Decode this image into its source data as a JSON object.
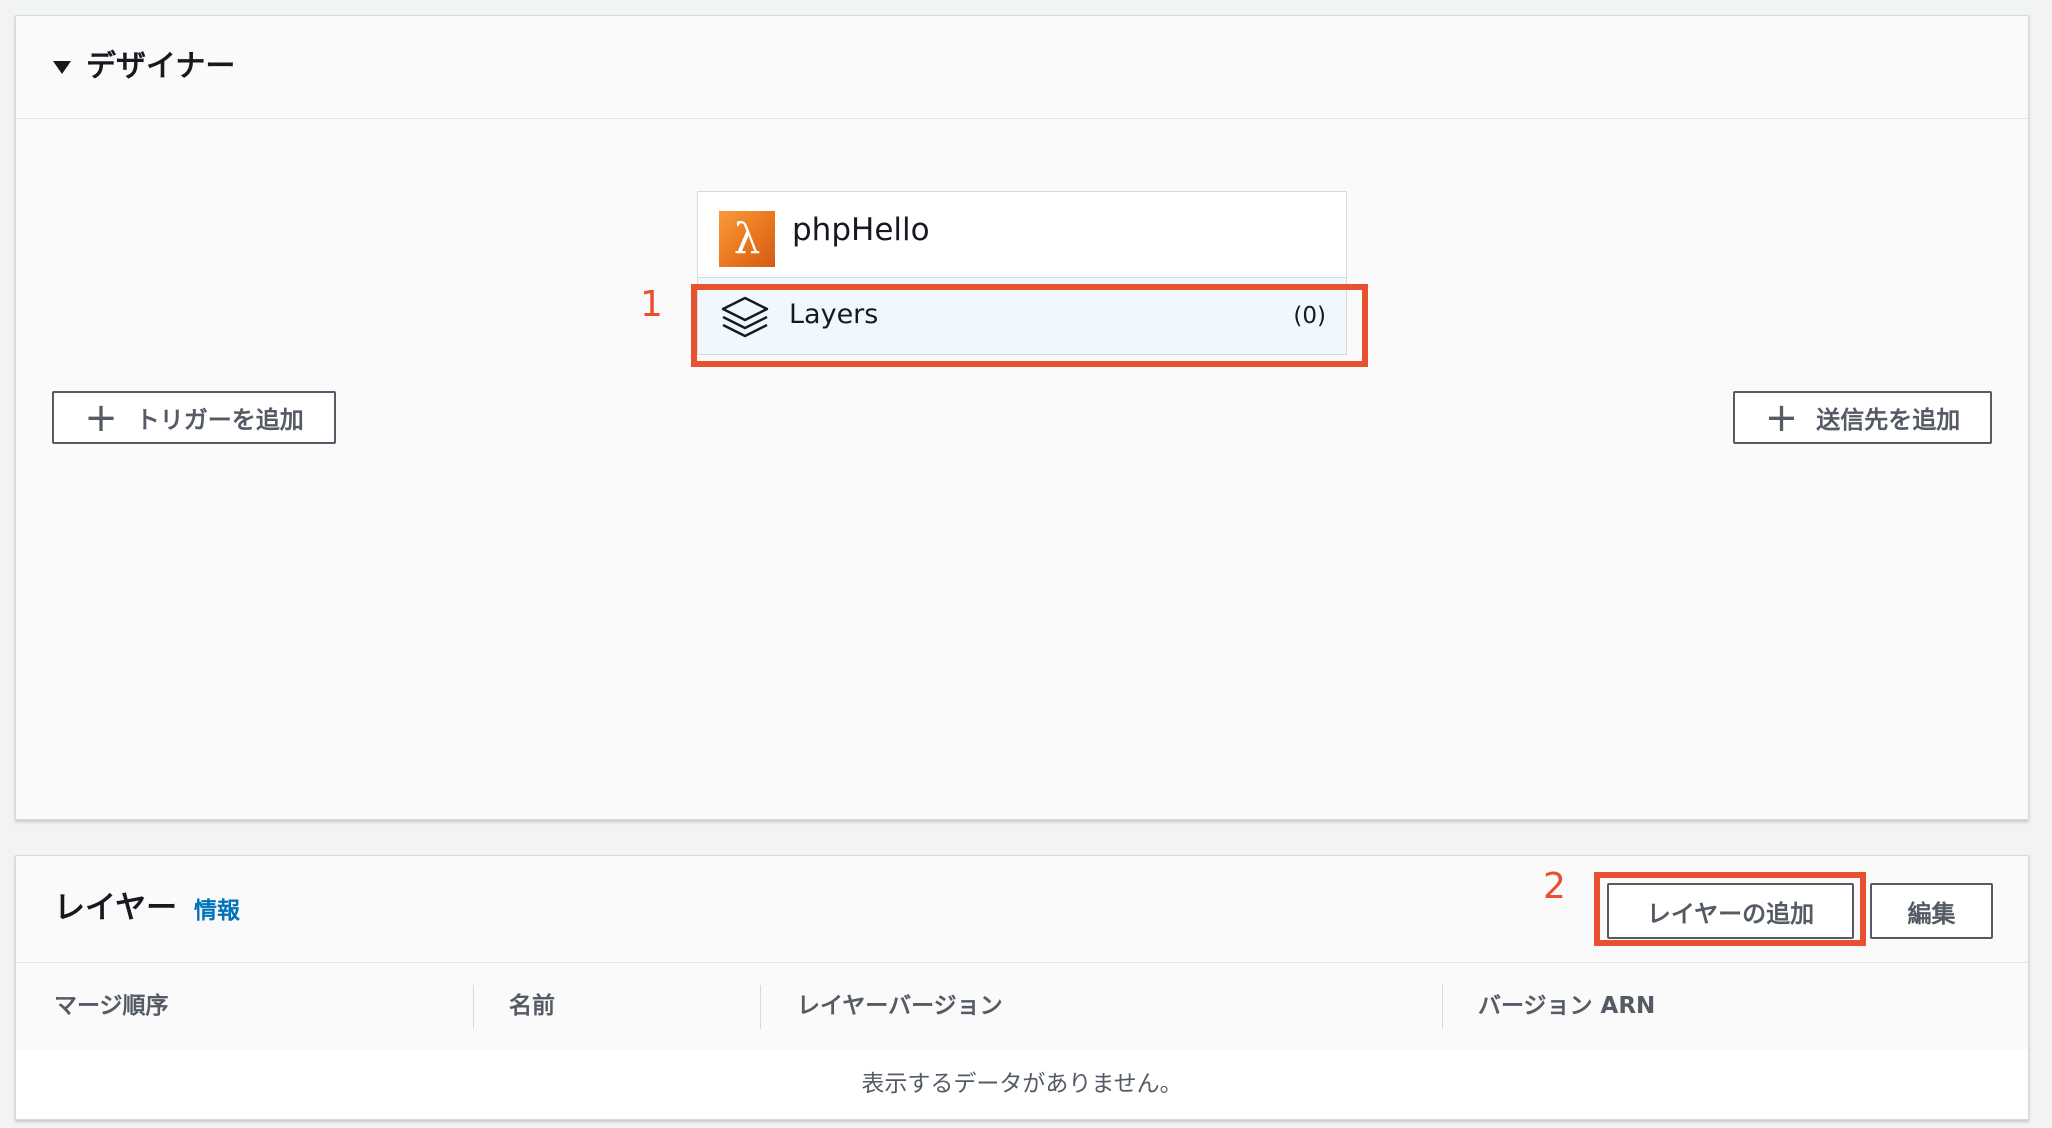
{
  "designer": {
    "title": "デザイナー",
    "function_name": "phpHello",
    "layers_label": "Layers",
    "layers_count": "(0)",
    "add_trigger": "トリガーを追加",
    "add_destination": "送信先を追加",
    "annotation_1": "1"
  },
  "layers_panel": {
    "title": "レイヤー",
    "info": "情報",
    "add_layer": "レイヤーの追加",
    "edit": "編集",
    "annotation_2": "2",
    "columns": [
      "マージ順序",
      "名前",
      "レイヤーバージョン",
      "バージョン ARN"
    ],
    "empty_message": "表示するデータがありません。"
  },
  "colors": {
    "annotation": "#e8512f",
    "link": "#0073bb",
    "lambda_orange": "#e8761e",
    "selected_row": "#f1f8fd"
  },
  "icons": [
    "caret-down-icon",
    "lambda-icon",
    "layers-icon",
    "plus-icon"
  ]
}
